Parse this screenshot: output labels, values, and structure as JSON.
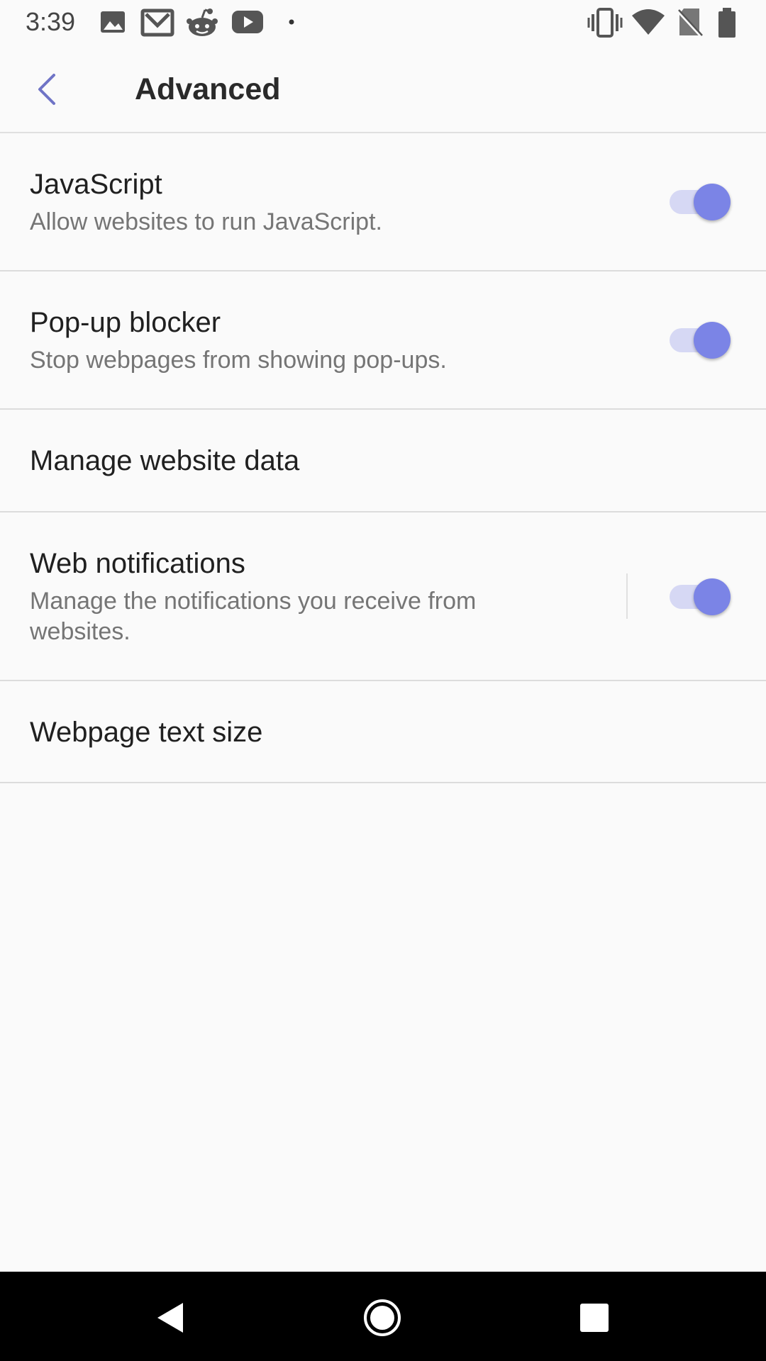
{
  "status_bar": {
    "time": "3:39",
    "left_icons": [
      "image-icon",
      "gmail-icon",
      "reddit-icon",
      "youtube-icon",
      "dot-icon"
    ],
    "right_icons": [
      "vibrate-icon",
      "wifi-icon",
      "no-sim-icon",
      "battery-icon"
    ]
  },
  "app_bar": {
    "title": "Advanced",
    "back_icon": "back-arrow-icon"
  },
  "settings": [
    {
      "title": "JavaScript",
      "subtitle": "Allow websites to run JavaScript.",
      "toggle": true
    },
    {
      "title": "Pop-up blocker",
      "subtitle": "Stop webpages from showing pop-ups.",
      "toggle": true
    },
    {
      "title": "Manage website data"
    },
    {
      "title": "Web notifications",
      "subtitle_line1": "Manage the notifications you receive from",
      "subtitle_line2": "websites.",
      "toggle": true
    },
    {
      "title": "Webpage text size"
    }
  ],
  "colors": {
    "accent": "#7b84e6",
    "track": "#d6d8f4",
    "back_arrow": "#6f74c6"
  },
  "nav_bar": {
    "icons": [
      "nav-back-icon",
      "nav-home-icon",
      "nav-recents-icon"
    ]
  }
}
